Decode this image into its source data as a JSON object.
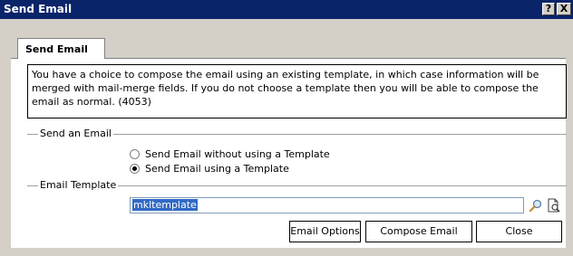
{
  "window": {
    "title": "Send Email",
    "help_glyph": "?",
    "close_glyph": "X"
  },
  "tab": {
    "label": "Send Email"
  },
  "description": "You have a choice to compose the email using an existing template, in which case information will be merged with mail-merge fields. If you do not choose a template then you will be able to compose the email as normal. (4053)",
  "send_group": {
    "label": "Send an Email",
    "options": [
      {
        "label": "Send Email without using a Template",
        "checked": false
      },
      {
        "label": "Send Email using a Template",
        "checked": true
      }
    ]
  },
  "template_group": {
    "label": "Email Template",
    "value": "mkltemplate"
  },
  "buttons": {
    "email_options": "Email Options",
    "compose_email": "Compose Email",
    "close": "Close"
  }
}
